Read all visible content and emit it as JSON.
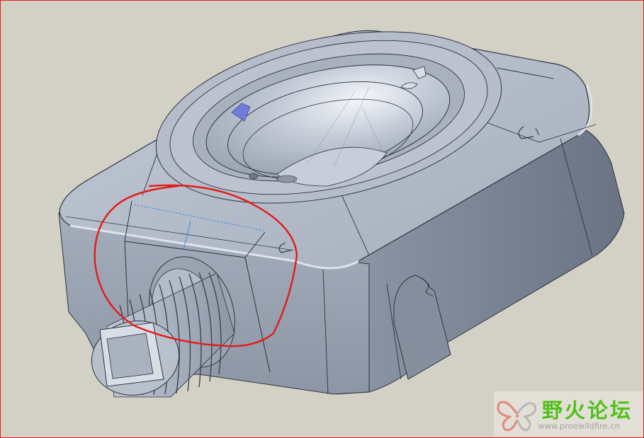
{
  "viewport": {
    "frame_color": "#e02020",
    "background": "#d3d1c5",
    "annotation_color": "#e21b1b",
    "model_color": "#a7b0bf"
  },
  "watermark": {
    "title": "野火论坛",
    "url": "www.proewildfire.cn",
    "icon": "butterfly-logo-icon",
    "title_color": "#52c01a"
  }
}
